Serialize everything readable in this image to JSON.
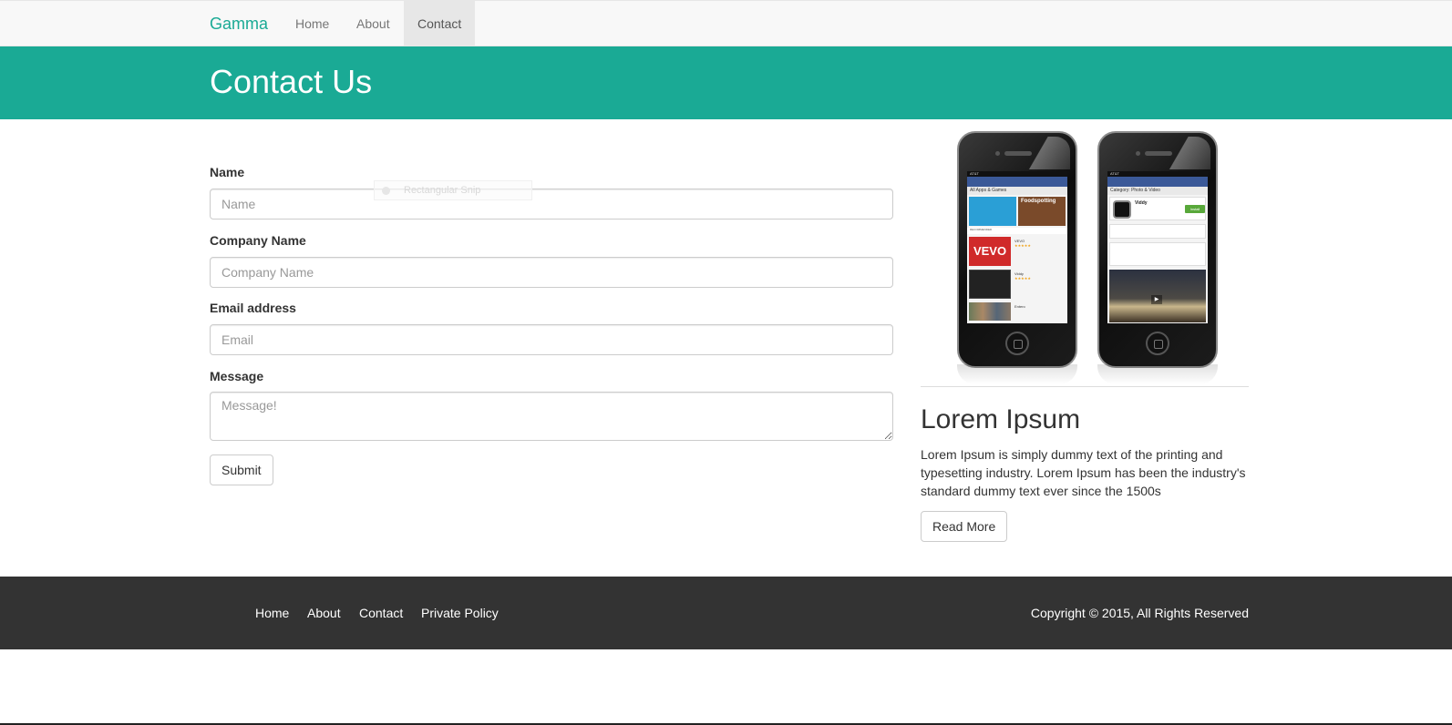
{
  "navbar": {
    "brand": "Gamma",
    "links": [
      {
        "label": "Home"
      },
      {
        "label": "About"
      },
      {
        "label": "Contact",
        "active": true
      }
    ]
  },
  "header": {
    "title": "Contact Us"
  },
  "form": {
    "name_label": "Name",
    "name_placeholder": "Name",
    "company_label": "Company Name",
    "company_placeholder": "Company Name",
    "email_label": "Email address",
    "email_placeholder": "Email",
    "message_label": "Message",
    "message_placeholder": "Message!",
    "submit_label": "Submit"
  },
  "snip_overlay": {
    "label": "Rectangular Snip"
  },
  "phones": {
    "phone1": {
      "status": "AT&T",
      "subbar": "All Apps & Games",
      "tile_label": "Foodspotting",
      "tabs": "RECOMMENDED",
      "app1_logo": "VEVO",
      "app1_name": "VEVO",
      "app2_name": "Viddy",
      "app3_name": "Entero"
    },
    "phone2": {
      "subbar": "Category: Photo & Video",
      "app_name": "Viddy",
      "install_label": "Install"
    }
  },
  "side": {
    "heading": "Lorem Ipsum",
    "text": "Lorem Ipsum is simply dummy text of the printing and typesetting industry. Lorem Ipsum has been the industry's standard dummy text ever since the 1500s",
    "button_label": "Read More"
  },
  "footer": {
    "links": [
      {
        "label": "Home"
      },
      {
        "label": "About"
      },
      {
        "label": "Contact"
      },
      {
        "label": "Private Policy"
      }
    ],
    "copyright": "Copyright © 2015, All Rights Reserved"
  },
  "colors": {
    "accent": "#1aaa95",
    "navbar_bg": "#f8f8f8",
    "footer_bg": "#333333"
  }
}
